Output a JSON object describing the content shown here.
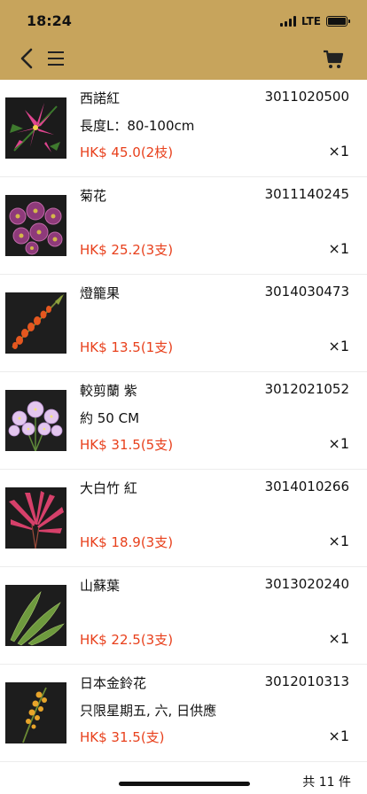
{
  "status": {
    "time": "18:24",
    "network": "LTE"
  },
  "header": {
    "back_icon": "chevron-left-icon",
    "menu_icon": "menu-icon",
    "cart_icon": "cart-icon"
  },
  "items": [
    {
      "name": "西諾紅",
      "code": "3011020500",
      "desc": "長度L：80-100cm",
      "price": "HK$ 45.0(2枝)",
      "qty": "×1",
      "image": "pink-lily"
    },
    {
      "name": "菊花",
      "code": "3011140245",
      "desc": "",
      "price": "HK$ 25.2(3支)",
      "qty": "×1",
      "image": "purple-chrysanthemum"
    },
    {
      "name": "燈籠果",
      "code": "3014030473",
      "desc": "",
      "price": "HK$ 13.5(1支)",
      "qty": "×1",
      "image": "orange-lantern-fruit"
    },
    {
      "name": "較剪蘭 紫",
      "code": "3012021052",
      "desc": "約 50 CM",
      "price": "HK$ 31.5(5支)",
      "qty": "×1",
      "image": "lilac-flowers"
    },
    {
      "name": "大白竹 紅",
      "code": "3014010266",
      "desc": "",
      "price": "HK$ 18.9(3支)",
      "qty": "×1",
      "image": "red-cordyline"
    },
    {
      "name": "山蘇葉",
      "code": "3013020240",
      "desc": "",
      "price": "HK$ 22.5(3支)",
      "qty": "×1",
      "image": "green-fern-leaves"
    },
    {
      "name": "日本金鈴花",
      "code": "3012010313",
      "desc": "只限星期五, 六, 日供應",
      "price": "HK$ 31.5(支)",
      "qty": "×1",
      "image": "yellow-bell-flower"
    }
  ],
  "footer": {
    "total": "共 11 件"
  },
  "colors": {
    "header": "#c7a45c",
    "price": "#e8401c"
  }
}
